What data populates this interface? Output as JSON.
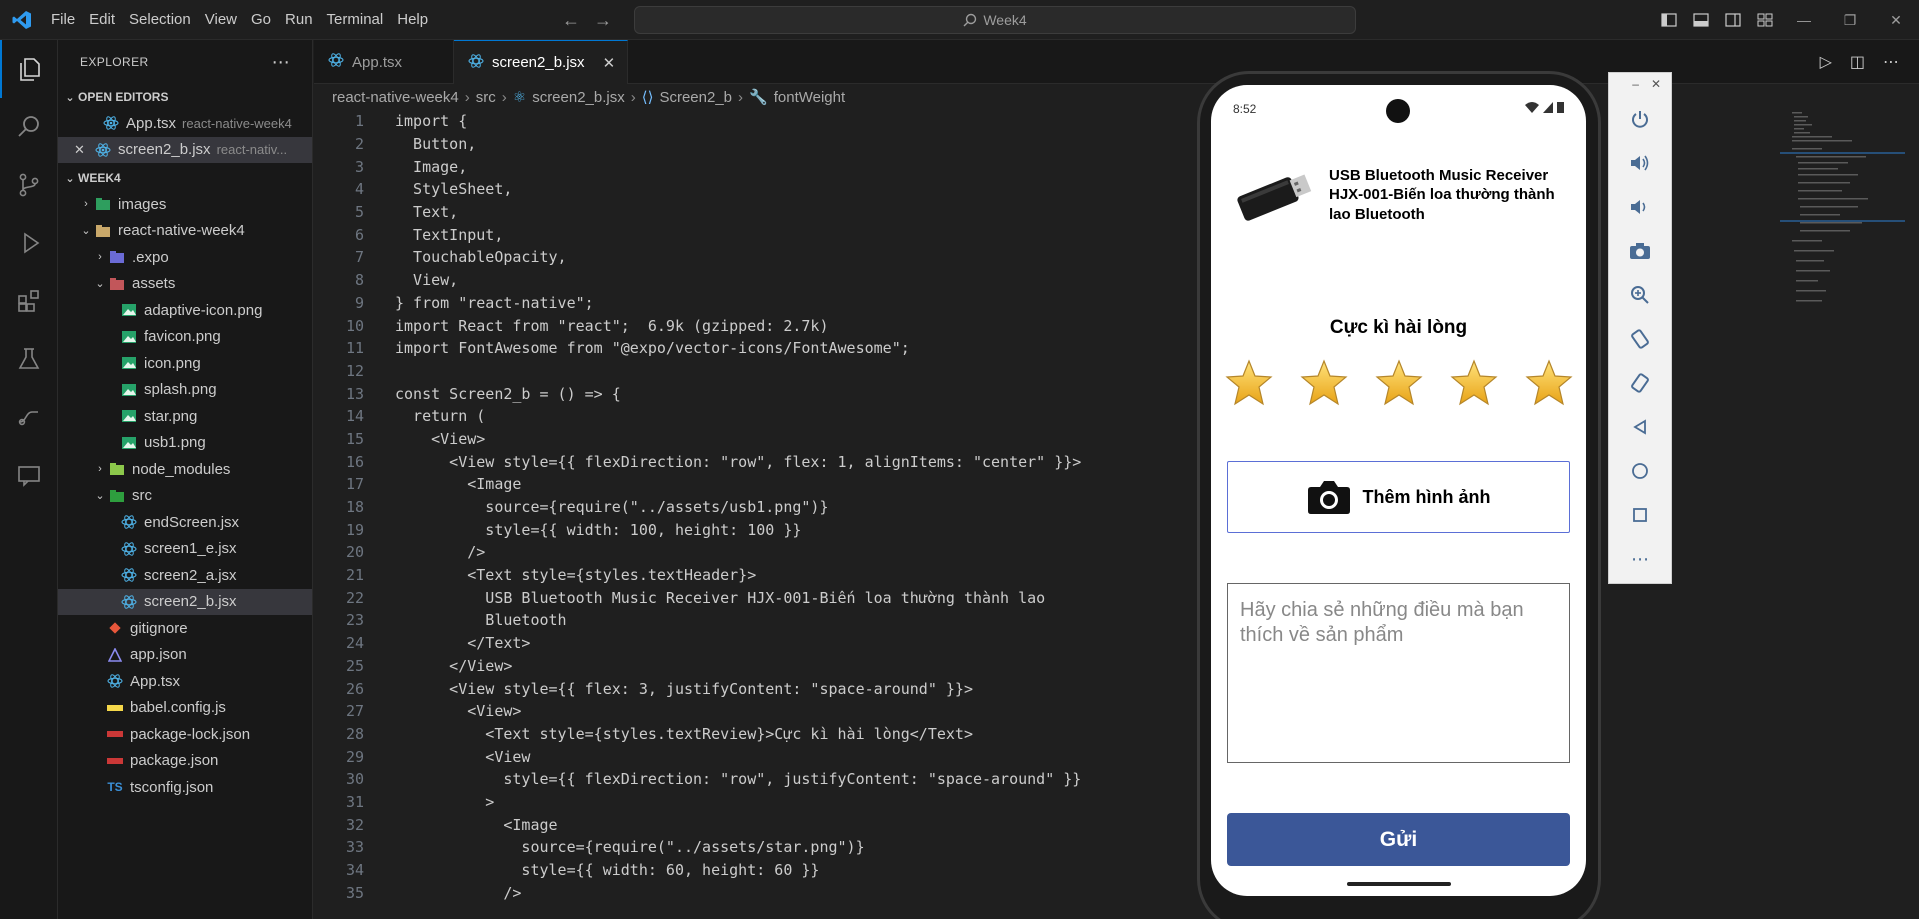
{
  "titlebar": {
    "menu": [
      "File",
      "Edit",
      "Selection",
      "View",
      "Go",
      "Run",
      "Terminal",
      "Help"
    ],
    "search_text": "Week4"
  },
  "explorer": {
    "header": "EXPLORER",
    "open_editors_label": "OPEN EDITORS",
    "open_editors": [
      {
        "name": "App.tsx",
        "path": "react-native-week4"
      },
      {
        "name": "screen2_b.jsx",
        "path": "react-nativ..."
      }
    ],
    "workspace_label": "WEEK4",
    "tree": {
      "images": "images",
      "project": "react-native-week4",
      "expo": ".expo",
      "assets": "assets",
      "asset_files": [
        "adaptive-icon.png",
        "favicon.png",
        "icon.png",
        "splash.png",
        "star.png",
        "usb1.png"
      ],
      "node_modules": "node_modules",
      "src": "src",
      "src_files": [
        "endScreen.jsx",
        "screen1_e.jsx",
        "screen2_a.jsx",
        "screen2_b.jsx"
      ],
      "root_files": [
        "gitignore",
        "app.json",
        "App.tsx",
        "babel.config.js",
        "package-lock.json",
        "package.json",
        "tsconfig.json"
      ]
    }
  },
  "tabs": [
    {
      "label": "App.tsx"
    },
    {
      "label": "screen2_b.jsx"
    }
  ],
  "breadcrumb": [
    "react-native-week4",
    "src",
    "screen2_b.jsx",
    "Screen2_b",
    "fontWeight"
  ],
  "code_lines": [
    "import {",
    "  Button,",
    "  Image,",
    "  StyleSheet,",
    "  Text,",
    "  TextInput,",
    "  TouchableOpacity,",
    "  View,",
    "} from \"react-native\";",
    "import React from \"react\";  6.9k (gzipped: 2.7k)",
    "import FontAwesome from \"@expo/vector-icons/FontAwesome\";",
    "",
    "const Screen2_b = () => {",
    "  return (",
    "    <View>",
    "      <View style={{ flexDirection: \"row\", flex: 1, alignItems: \"center\" }}>",
    "        <Image",
    "          source={require(\"../assets/usb1.png\")}",
    "          style={{ width: 100, height: 100 }}",
    "        />",
    "        <Text style={styles.textHeader}>",
    "          USB Bluetooth Music Receiver HJX-001-Biến loa thường thành lao",
    "          Bluetooth",
    "        </Text>",
    "      </View>",
    "      <View style={{ flex: 3, justifyContent: \"space-around\" }}>",
    "        <View>",
    "          <Text style={styles.textReview}>Cực kì hài lòng</Text>",
    "          <View",
    "            style={{ flexDirection: \"row\", justifyContent: \"space-around\" }}",
    "          >",
    "            <Image",
    "              source={require(\"../assets/star.png\")}",
    "              style={{ width: 60, height: 60 }}",
    "            />"
  ],
  "phone": {
    "time": "8:52",
    "product_title": "USB Bluetooth Music Receiver HJX-001-Biến loa thường thành lao Bluetooth",
    "review_label": "Cực kì hài lòng",
    "star_count": 5,
    "add_photo_label": "Thêm hình ảnh",
    "review_placeholder": "Hãy chia sẻ những điều mà bạn thích về sản phẩm",
    "submit_label": "Gửi"
  },
  "colors": {
    "accent": "#0078d4",
    "submit_bg": "#3b5798",
    "add_photo_border": "#5b6fd6"
  }
}
